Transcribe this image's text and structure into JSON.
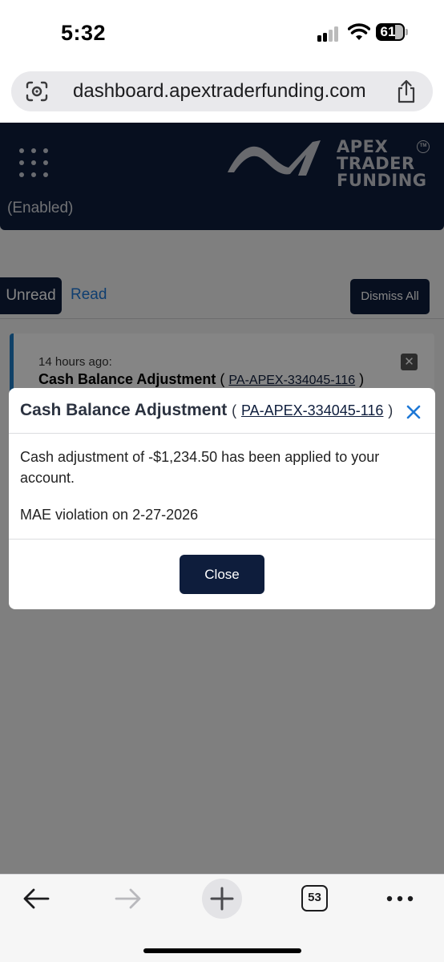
{
  "status_bar": {
    "time": "5:32",
    "battery": "61"
  },
  "browser": {
    "url": "dashboard.apextraderfunding.com",
    "tab_count": "53"
  },
  "header": {
    "logo_lines": [
      "APEX",
      "TRADER",
      "FUNDING"
    ],
    "logo_tm": "TM",
    "enabled_text": "(Enabled)"
  },
  "tabs": {
    "unread_label": "Unread",
    "read_label": "Read",
    "dismiss_all_label": "Dismiss All"
  },
  "notification": {
    "time": "14 hours ago:",
    "title": "Cash Balance Adjustment",
    "open_paren": "(",
    "account": "PA-APEX-334045-116",
    "close_paren": ")",
    "dismiss_icon": "x-icon"
  },
  "modal": {
    "title": "Cash Balance Adjustment",
    "open_paren": "(",
    "account": "PA-APEX-334045-116",
    "close_paren": ")",
    "message": "Cash adjustment of -$1,234.50 has been applied to your account.",
    "note": "MAE violation on 2-27-2026",
    "close_label": "Close"
  },
  "colors": {
    "navy": "#0e1d3c",
    "link_blue": "#1e78d6",
    "accent_blue": "#1f7ec6"
  },
  "icons": [
    "signal-icon",
    "wifi-icon",
    "battery-icon",
    "lens-icon",
    "share-icon",
    "grid-menu-icon",
    "apex-logo",
    "close-icon",
    "back-icon",
    "forward-icon",
    "new-tab-icon",
    "tabs-icon",
    "more-icon"
  ]
}
